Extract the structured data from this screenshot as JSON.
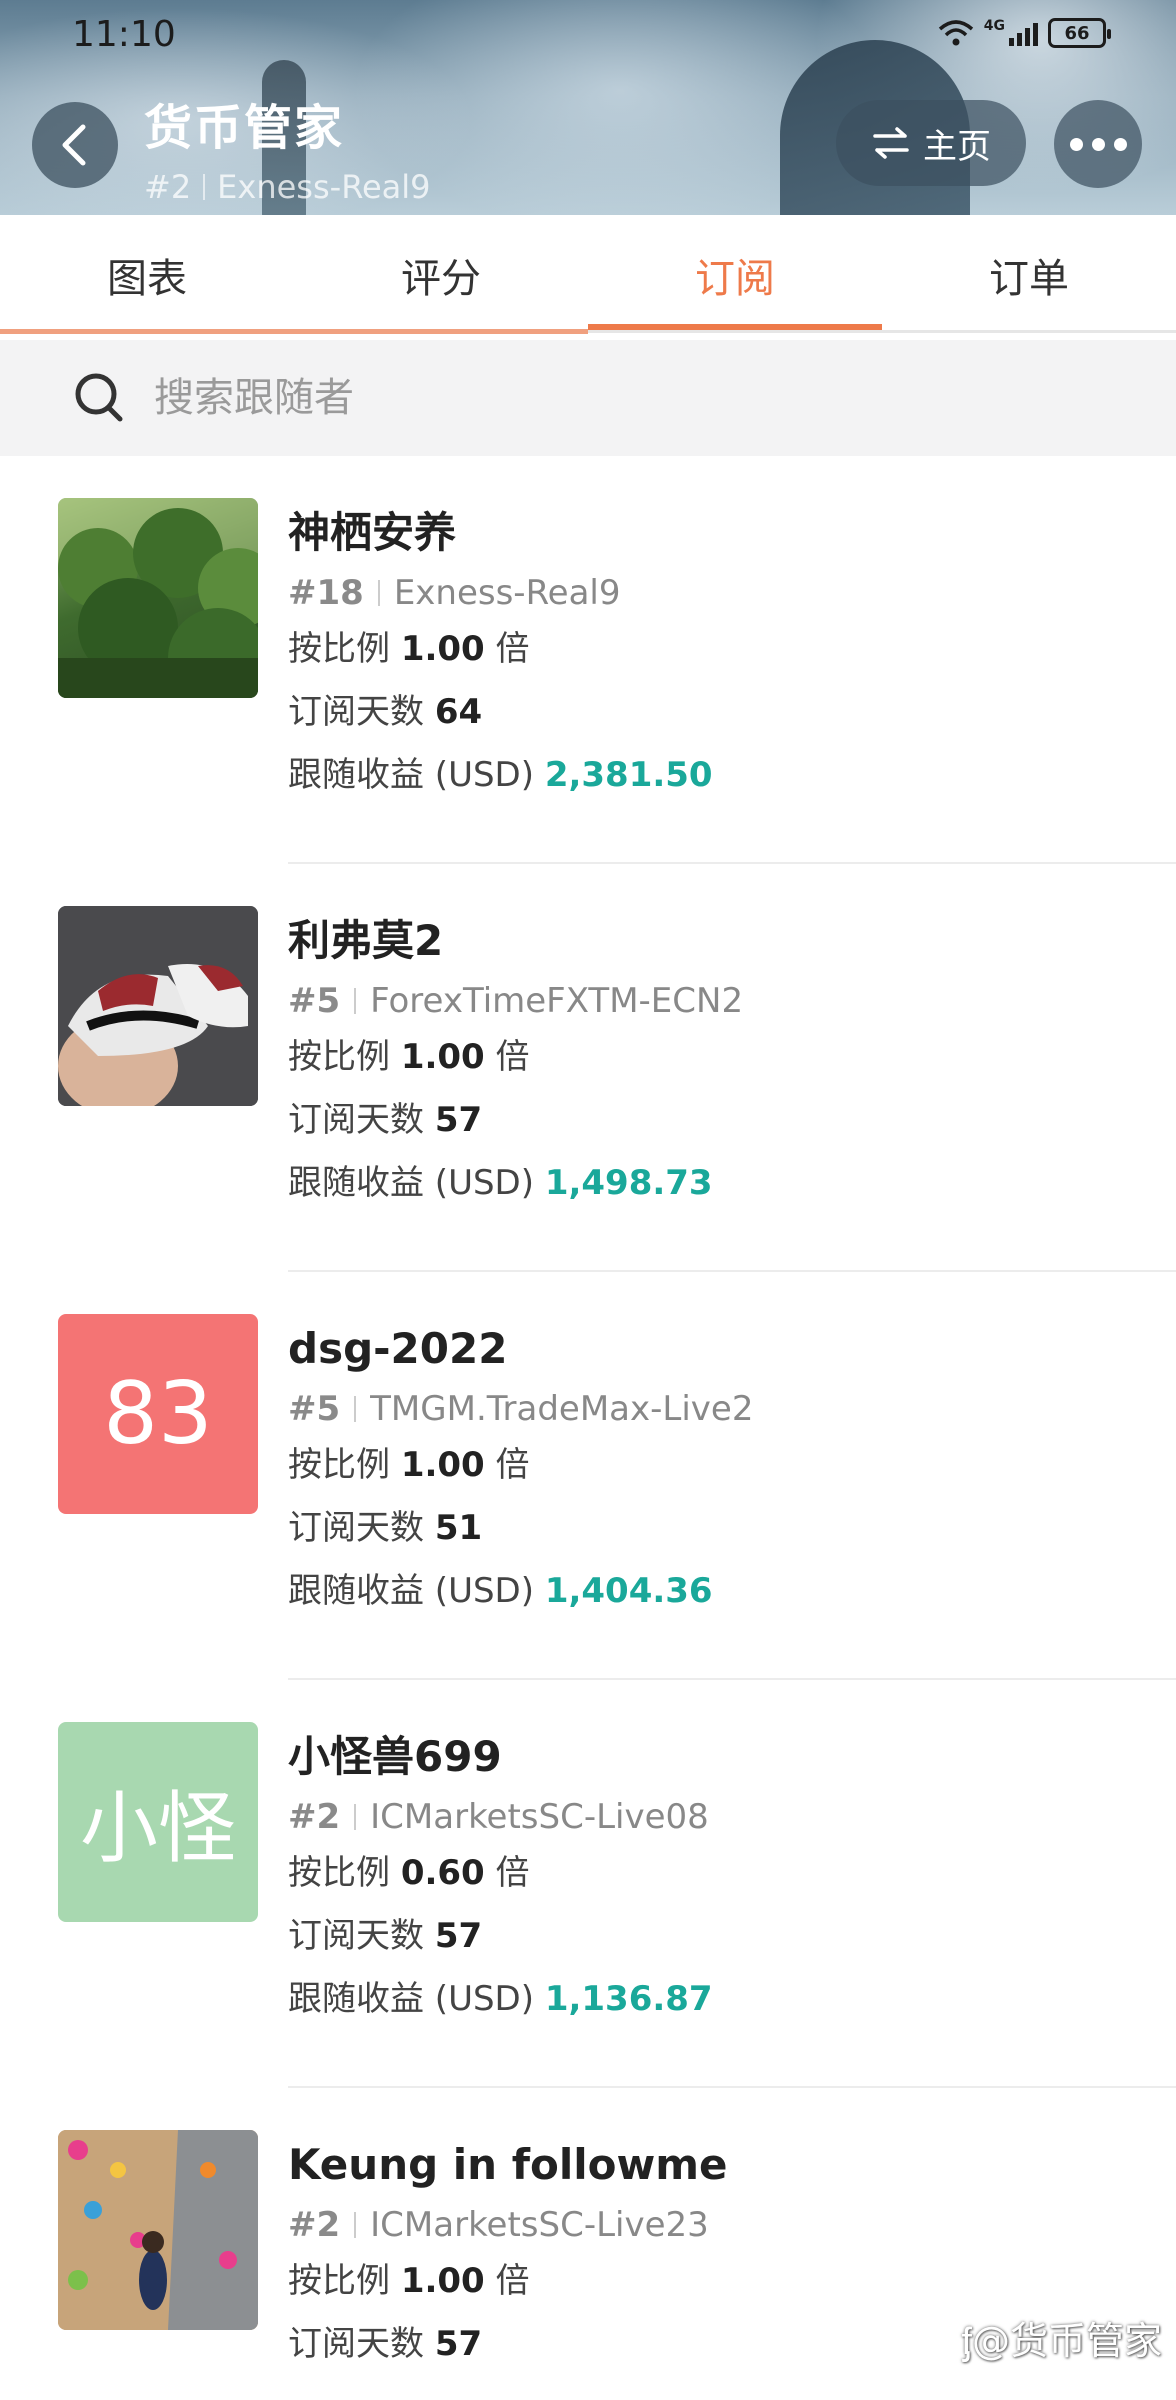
{
  "status_bar": {
    "time": "11:10",
    "network": "4G",
    "battery": "66"
  },
  "header": {
    "title": "货币管家",
    "rank": "#2",
    "server": "Exness-Real9",
    "home_label": "主页"
  },
  "tabs": [
    {
      "label": "图表",
      "active": false
    },
    {
      "label": "评分",
      "active": false
    },
    {
      "label": "订阅",
      "active": true
    },
    {
      "label": "订单",
      "active": false
    }
  ],
  "search": {
    "placeholder": "搜索跟随者"
  },
  "labels": {
    "ratio": "按比例",
    "ratio_unit": "倍",
    "days": "订阅天数",
    "profit": "跟随收益 (USD)"
  },
  "followers": [
    {
      "name": "神栖安养",
      "rank": "#18",
      "server": "Exness-Real9",
      "ratio": "1.00",
      "days": "64",
      "profit": "2,381.50",
      "avatar": "photo-forest"
    },
    {
      "name": "利弗莫2",
      "rank": "#5",
      "server": "ForexTimeFXTM-ECN2",
      "ratio": "1.00",
      "days": "57",
      "profit": "1,498.73",
      "avatar": "photo-sneakers"
    },
    {
      "name": "dsg-2022",
      "rank": "#5",
      "server": "TMGM.TradeMax-Live2",
      "ratio": "1.00",
      "days": "51",
      "profit": "1,404.36",
      "avatar_text": "83",
      "avatar_color": "#f47474"
    },
    {
      "name": "小怪兽699",
      "rank": "#2",
      "server": "ICMarketsSC-Live08",
      "ratio": "0.60",
      "days": "57",
      "profit": "1,136.87",
      "avatar_text": "小怪",
      "avatar_color": "#a8d8b0"
    },
    {
      "name": "Keung in followme",
      "rank": "#2",
      "server": "ICMarketsSC-Live23",
      "ratio": "1.00",
      "days": "57",
      "avatar": "photo-climbing-wall"
    }
  ],
  "watermark": "@货币管家",
  "colors": {
    "accent": "#ee7a4a",
    "profit": "#1aa89a"
  }
}
